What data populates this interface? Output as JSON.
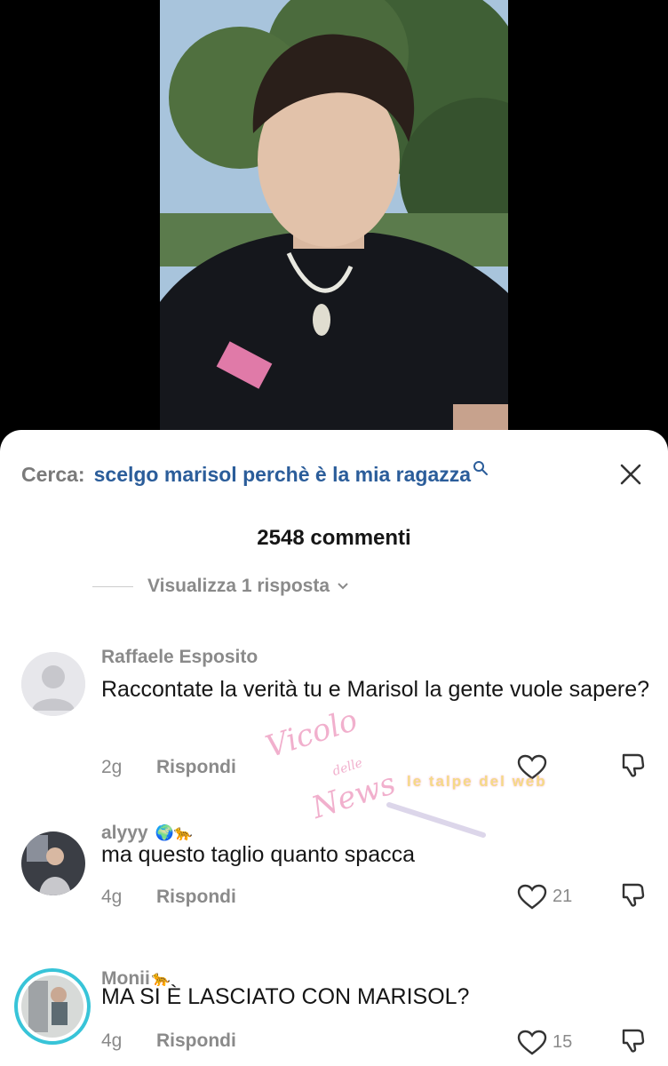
{
  "search": {
    "label": "Cerca:",
    "query": "scelgo marisol perchè è la mia ragazza"
  },
  "comments_header": {
    "count": "2548 commenti",
    "view_replies": "Visualizza 1 risposta"
  },
  "comments": [
    {
      "user": "Raffaele Esposito",
      "emojis": "",
      "text": "Raccontate la verità tu e Marisol la gente vuole sapere?",
      "age": "2g",
      "reply": "Rispondi",
      "likes": ""
    },
    {
      "user": "alyyy",
      "emojis": "🌍🐆",
      "text": "ma questo taglio quanto spacca",
      "age": "4g",
      "reply": "Rispondi",
      "likes": "21"
    },
    {
      "user": "Monii",
      "emojis": "🐆",
      "text": "MA SI È LASCIATO CON MARISOL?",
      "age": "4g",
      "reply": "Rispondi",
      "likes": "15"
    }
  ],
  "watermark": {
    "vicolo": "Vicolo",
    "delle": "delle",
    "news": "News",
    "talpe": "le talpe del web"
  },
  "colors": {
    "link": "#2b5d9a",
    "muted": "#8a8a8a",
    "text": "#161616"
  },
  "icons": [
    "search-icon",
    "close-icon",
    "chevron-down-icon",
    "heart-icon",
    "dislike-icon"
  ]
}
